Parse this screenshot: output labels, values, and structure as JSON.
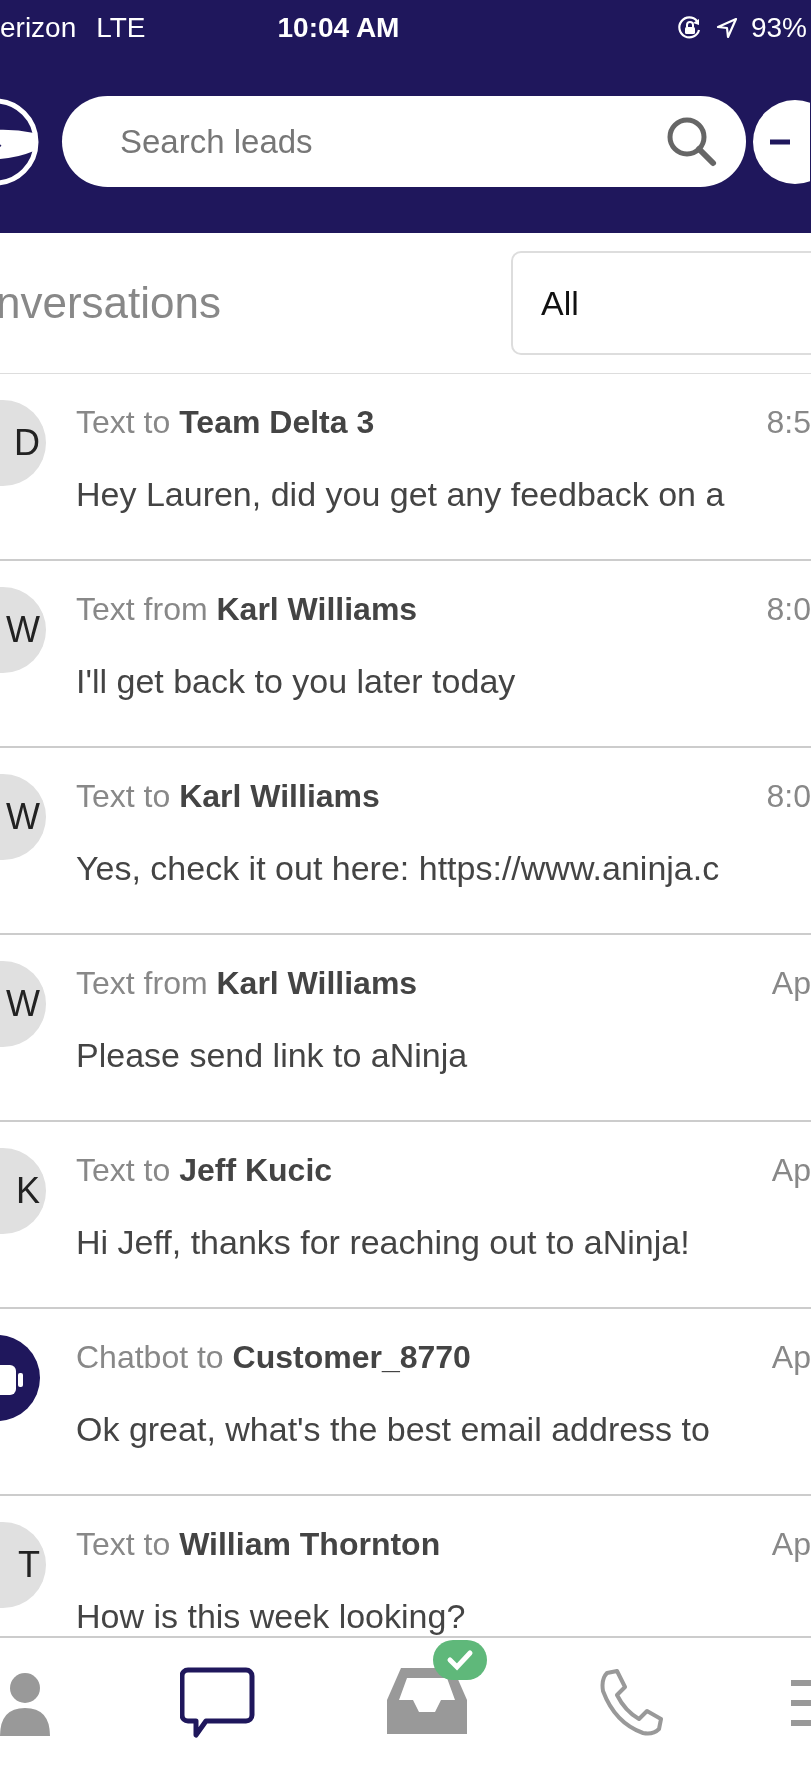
{
  "status_bar": {
    "carrier": "erizon",
    "network": "LTE",
    "time": "10:04 AM",
    "battery": "93%"
  },
  "search": {
    "placeholder": "Search leads"
  },
  "title": "nversations",
  "filter": {
    "value": "All"
  },
  "conversations": [
    {
      "kind": "initials",
      "initials": "D",
      "line": "Text to **Team Delta 3**",
      "time": "8:5",
      "preview": "Hey Lauren, did you get any feedback on a"
    },
    {
      "kind": "initials",
      "initials": "W",
      "line": "Text from **Karl Williams**",
      "time": "8:0",
      "preview": "I'll get back to you later today"
    },
    {
      "kind": "initials",
      "initials": "W",
      "line": "Text to **Karl Williams**",
      "time": "8:0",
      "preview": "Yes, check it out here: https://www.aninja.c"
    },
    {
      "kind": "initials",
      "initials": "W",
      "line": "Text from **Karl Williams**",
      "time": "Ap",
      "preview": "Please send link to aNinja"
    },
    {
      "kind": "initials",
      "initials": "K",
      "line": "Text to **Jeff Kucic**",
      "time": "Ap",
      "preview": "Hi Jeff, thanks for reaching out to aNinja!"
    },
    {
      "kind": "bot",
      "line": "Chatbot to **Customer_8770**",
      "time": "Ap",
      "preview": "Ok great, what's the best email address to"
    },
    {
      "kind": "initials",
      "initials": "T",
      "line": "Text to **William Thornton**",
      "time": "Ap",
      "preview": "How is this week looking?"
    }
  ],
  "nav": [
    {
      "selected": false
    },
    {
      "selected": true
    },
    {
      "selected": false,
      "badge": true
    },
    {
      "selected": false
    },
    {
      "selected": false
    }
  ]
}
